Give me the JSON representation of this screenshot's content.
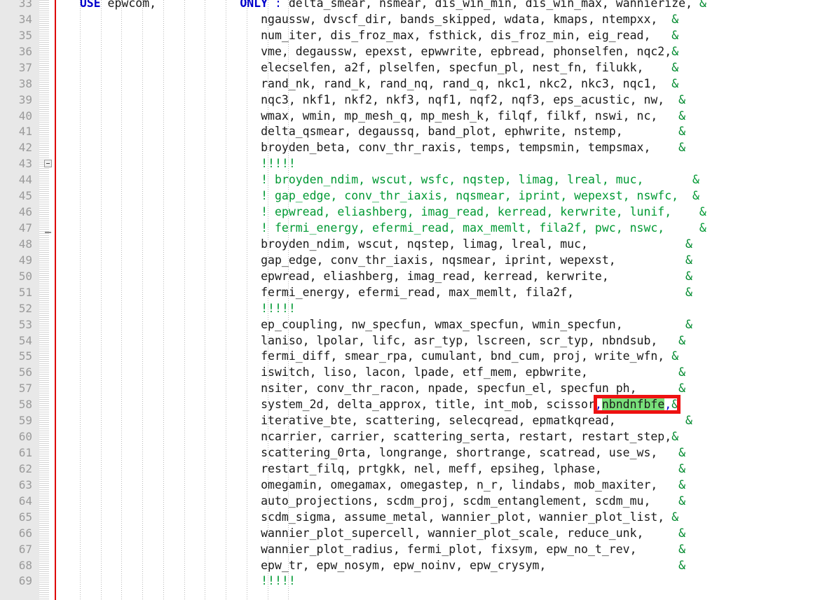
{
  "editor": {
    "language": "Fortran",
    "first_visible_line": 33,
    "last_visible_line": 69,
    "current_line": 58,
    "colors": {
      "background": "#ffffff",
      "gutter": "#e8e8e8",
      "line_number": "#9a9a9a",
      "keyword": "#0000cc",
      "comment": "#009933",
      "continuation": "#008a2e",
      "current_line_highlight": "#e8e8fb",
      "search_hit": "#79e07a",
      "annotation": "#ee1111",
      "change_bar": "#dd0000"
    }
  },
  "search": {
    "hit_text": "nbndnfbfe",
    "hit_line": 58
  },
  "fold_markers": {
    "collapse_at_line": 43,
    "fold_end_at_line": 47
  },
  "lines": [
    {
      "num": 33,
      "segments": [
        {
          "t": "   ",
          "c": "plain"
        },
        {
          "t": "USE",
          "c": "kw"
        },
        {
          "t": " epwcom,            ",
          "c": "plain"
        },
        {
          "t": "ONLY",
          "c": "kw"
        },
        {
          "t": " ",
          "c": "plain"
        },
        {
          "t": ":",
          "c": "punct"
        },
        {
          "t": " delta_smear, nsmear, dis_win_min, dis_win_max, wannierize, ",
          "c": "plain"
        },
        {
          "t": "&",
          "c": "amp"
        }
      ]
    },
    {
      "num": 34,
      "segments": [
        {
          "t": "                             ngaussw, dvscf_dir, bands_skipped, wdata, kmaps, ntempxx,  ",
          "c": "plain"
        },
        {
          "t": "&",
          "c": "amp"
        }
      ]
    },
    {
      "num": 35,
      "segments": [
        {
          "t": "                             num_iter, dis_froz_max, fsthick, dis_froz_min, eig_read,   ",
          "c": "plain"
        },
        {
          "t": "&",
          "c": "amp"
        }
      ]
    },
    {
      "num": 36,
      "segments": [
        {
          "t": "                             vme, degaussw, epexst, epwwrite, epbread, phonselfen, nqc2,",
          "c": "plain"
        },
        {
          "t": "&",
          "c": "amp"
        }
      ]
    },
    {
      "num": 37,
      "segments": [
        {
          "t": "                             elecselfen, a2f, plselfen, specfun_pl, nest_fn, filukk,    ",
          "c": "plain"
        },
        {
          "t": "&",
          "c": "amp"
        }
      ]
    },
    {
      "num": 38,
      "segments": [
        {
          "t": "                             rand_nk, rand_k, rand_nq, rand_q, nkc1, nkc2, nkc3, nqc1,  ",
          "c": "plain"
        },
        {
          "t": "&",
          "c": "amp"
        }
      ]
    },
    {
      "num": 39,
      "segments": [
        {
          "t": "                             nqc3, nkf1, nkf2, nkf3, nqf1, nqf2, nqf3, eps_acustic, nw,  ",
          "c": "plain"
        },
        {
          "t": "&",
          "c": "amp"
        }
      ]
    },
    {
      "num": 40,
      "segments": [
        {
          "t": "                             wmax, wmin, mp_mesh_q, mp_mesh_k, filqf, filkf, nswi, nc,   ",
          "c": "plain"
        },
        {
          "t": "&",
          "c": "amp"
        }
      ]
    },
    {
      "num": 41,
      "segments": [
        {
          "t": "                             delta_qsmear, degaussq, band_plot, ephwrite, nstemp,        ",
          "c": "plain"
        },
        {
          "t": "&",
          "c": "amp"
        }
      ]
    },
    {
      "num": 42,
      "segments": [
        {
          "t": "                             broyden_beta, conv_thr_raxis, temps, tempsmin, tempsmax,    ",
          "c": "plain"
        },
        {
          "t": "&",
          "c": "amp"
        }
      ]
    },
    {
      "num": 43,
      "segments": [
        {
          "t": "                             !!!!!",
          "c": "comment"
        }
      ]
    },
    {
      "num": 44,
      "segments": [
        {
          "t": "                             ! broyden_ndim, wscut, wsfc, nqstep, limag, lreal, muc,       &",
          "c": "comment"
        }
      ]
    },
    {
      "num": 45,
      "segments": [
        {
          "t": "                             ! gap_edge, conv_thr_iaxis, nqsmear, iprint, wepexst, nswfc,  &",
          "c": "comment"
        }
      ]
    },
    {
      "num": 46,
      "segments": [
        {
          "t": "                             ! epwread, eliashberg, imag_read, kerread, kerwrite, lunif,    &",
          "c": "comment"
        }
      ]
    },
    {
      "num": 47,
      "segments": [
        {
          "t": "                             ! fermi_energy, efermi_read, max_memlt, fila2f, pwc, nswc,     &",
          "c": "comment"
        }
      ]
    },
    {
      "num": 48,
      "segments": [
        {
          "t": "                             broyden_ndim, wscut, nqstep, limag, lreal, muc,              ",
          "c": "plain"
        },
        {
          "t": "&",
          "c": "amp"
        }
      ]
    },
    {
      "num": 49,
      "segments": [
        {
          "t": "                             gap_edge, conv_thr_iaxis, nqsmear, iprint, wepexst,          ",
          "c": "plain"
        },
        {
          "t": "&",
          "c": "amp"
        }
      ]
    },
    {
      "num": 50,
      "segments": [
        {
          "t": "                             epwread, eliashberg, imag_read, kerread, kerwrite,           ",
          "c": "plain"
        },
        {
          "t": "&",
          "c": "amp"
        }
      ]
    },
    {
      "num": 51,
      "segments": [
        {
          "t": "                             fermi_energy, efermi_read, max_memlt, fila2f,                ",
          "c": "plain"
        },
        {
          "t": "&",
          "c": "amp"
        }
      ]
    },
    {
      "num": 52,
      "segments": [
        {
          "t": "                             !!!!!",
          "c": "comment"
        }
      ]
    },
    {
      "num": 53,
      "segments": [
        {
          "t": "                             ep_coupling, nw_specfun, wmax_specfun, wmin_specfun,         ",
          "c": "plain"
        },
        {
          "t": "&",
          "c": "amp"
        }
      ]
    },
    {
      "num": 54,
      "segments": [
        {
          "t": "                             laniso, lpolar, lifc, asr_typ, lscreen, scr_typ, nbndsub,   ",
          "c": "plain"
        },
        {
          "t": "&",
          "c": "amp"
        }
      ]
    },
    {
      "num": 55,
      "segments": [
        {
          "t": "                             fermi_diff, smear_rpa, cumulant, bnd_cum, proj, write_wfn, ",
          "c": "plain"
        },
        {
          "t": "&",
          "c": "amp"
        }
      ]
    },
    {
      "num": 56,
      "segments": [
        {
          "t": "                             iswitch, liso, lacon, lpade, etf_mem, epbwrite,             ",
          "c": "plain"
        },
        {
          "t": "&",
          "c": "amp"
        }
      ]
    },
    {
      "num": 57,
      "segments": [
        {
          "t": "                             nsiter, conv_thr_racon, npade, specfun_el, specfun ph,      ",
          "c": "plain"
        },
        {
          "t": "&",
          "c": "amp"
        }
      ]
    },
    {
      "num": 58,
      "segments": [
        {
          "t": "                             system_2d, delta_approx, title, int_mob, scissor",
          "c": "plain"
        },
        {
          "t": ",",
          "c": "punct"
        },
        {
          "t": "nbndnfbfe",
          "c": "hit"
        },
        {
          "t": ",",
          "c": "punct"
        },
        {
          "t": "&",
          "c": "amp"
        }
      ]
    },
    {
      "num": 59,
      "segments": [
        {
          "t": "                             iterative_bte, scattering, selecqread, epmatkqread,          ",
          "c": "plain"
        },
        {
          "t": "&",
          "c": "amp"
        }
      ]
    },
    {
      "num": 60,
      "segments": [
        {
          "t": "                             ncarrier, carrier, scattering_serta, restart, restart_step,",
          "c": "plain"
        },
        {
          "t": "&",
          "c": "amp"
        }
      ]
    },
    {
      "num": 61,
      "segments": [
        {
          "t": "                             scattering_0rta, longrange, shortrange, scatread, use_ws,   ",
          "c": "plain"
        },
        {
          "t": "&",
          "c": "amp"
        }
      ]
    },
    {
      "num": 62,
      "segments": [
        {
          "t": "                             restart_filq, prtgkk, nel, meff, epsiheg, lphase,           ",
          "c": "plain"
        },
        {
          "t": "&",
          "c": "amp"
        }
      ]
    },
    {
      "num": 63,
      "segments": [
        {
          "t": "                             omegamin, omegamax, omegastep, n_r, lindabs, mob_maxiter,   ",
          "c": "plain"
        },
        {
          "t": "&",
          "c": "amp"
        }
      ]
    },
    {
      "num": 64,
      "segments": [
        {
          "t": "                             auto_projections, scdm_proj, scdm_entanglement, scdm_mu,    ",
          "c": "plain"
        },
        {
          "t": "&",
          "c": "amp"
        }
      ]
    },
    {
      "num": 65,
      "segments": [
        {
          "t": "                             scdm_sigma, assume_metal, wannier_plot, wannier_plot_list, ",
          "c": "plain"
        },
        {
          "t": "&",
          "c": "amp"
        }
      ]
    },
    {
      "num": 66,
      "segments": [
        {
          "t": "                             wannier_plot_supercell, wannier_plot_scale, reduce_unk,     ",
          "c": "plain"
        },
        {
          "t": "&",
          "c": "amp"
        }
      ]
    },
    {
      "num": 67,
      "segments": [
        {
          "t": "                             wannier_plot_radius, fermi_plot, fixsym, epw_no_t_rev,      ",
          "c": "plain"
        },
        {
          "t": "&",
          "c": "amp"
        }
      ]
    },
    {
      "num": 68,
      "segments": [
        {
          "t": "                             epw_tr, epw_nosym, epw_noinv, epw_crysym,                   ",
          "c": "plain"
        },
        {
          "t": "&",
          "c": "amp"
        }
      ]
    },
    {
      "num": 69,
      "segments": [
        {
          "t": "                             !!!!!",
          "c": "comment"
        }
      ]
    }
  ]
}
